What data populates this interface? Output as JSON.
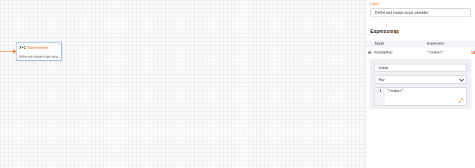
{
  "node": {
    "icon_label": "X+1",
    "title": "Expressions",
    "close": "×",
    "description": "Define and mutate scope variables"
  },
  "panel": {
    "label_title": "Label",
    "label_value": "Define and mutate scope variables",
    "expressions_heading": "Expressions",
    "help_glyph": "?",
    "columns": {
      "target": "Target",
      "expression": "Expression"
    },
    "rows": [
      {
        "target": "foobar(Any)",
        "expression": "\"foobar\""
      }
    ],
    "editor": {
      "target_value": "foobar",
      "type_value": "Any",
      "line_number": "1",
      "code": "\"foobar\""
    }
  },
  "colors": {
    "accent": "#f2813a",
    "node_border": "#8fb8de",
    "danger": "#e26a4a"
  }
}
